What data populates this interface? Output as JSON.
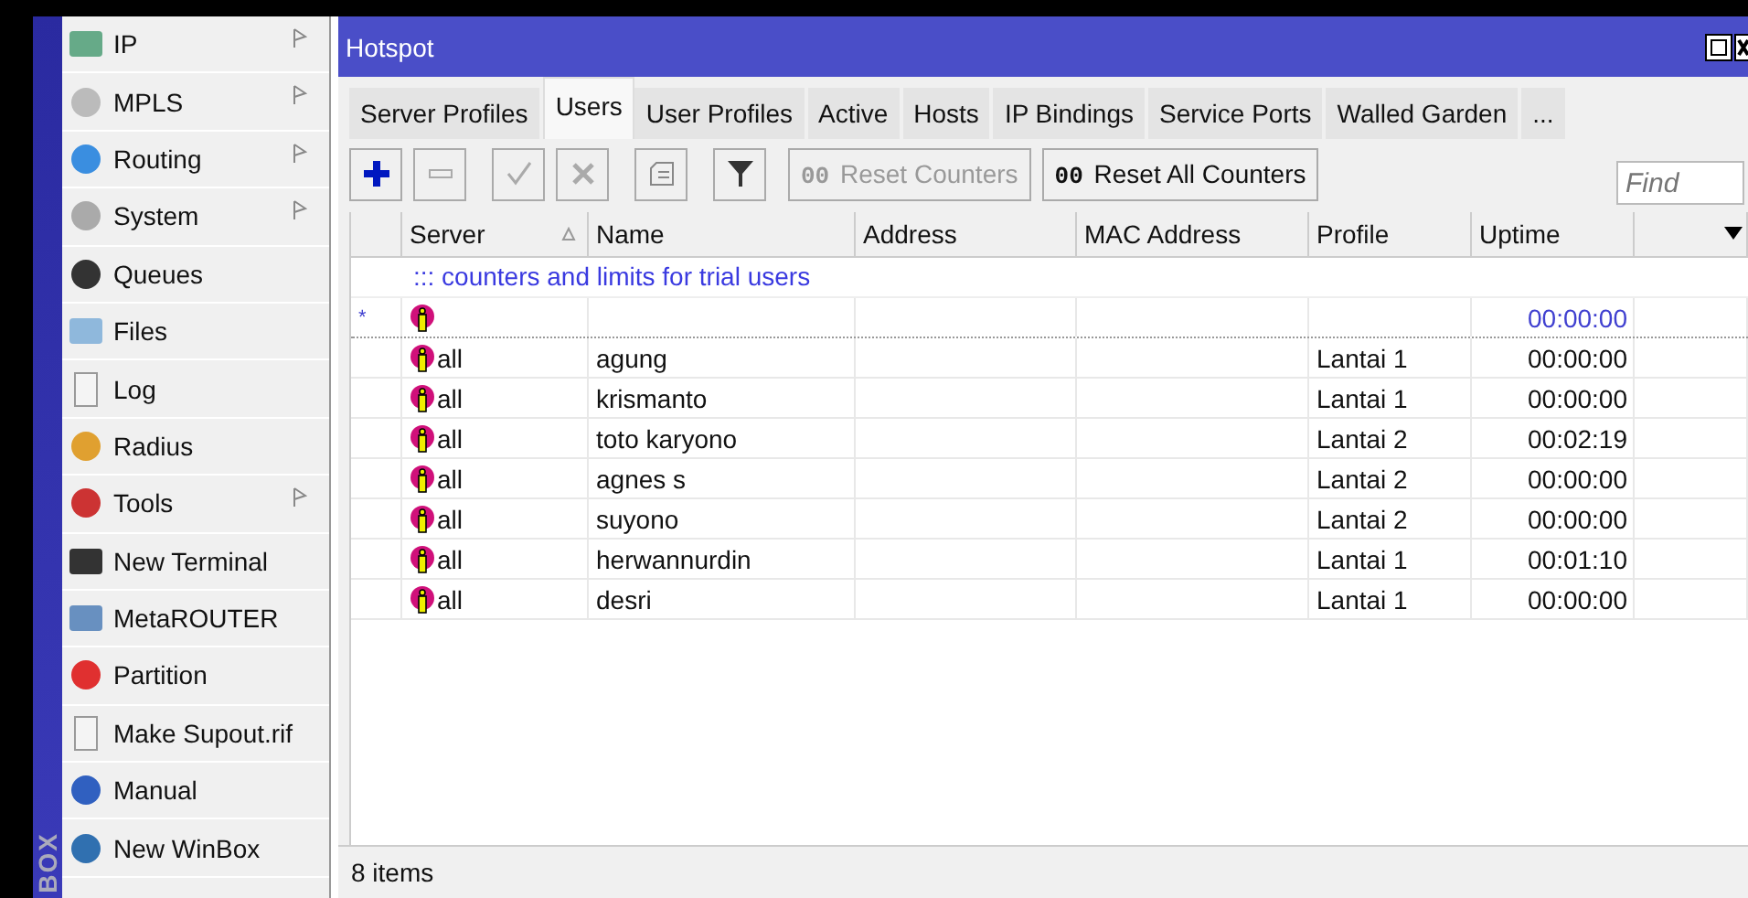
{
  "side_label": "BOX",
  "menu": [
    {
      "label": "IP",
      "submenu": true
    },
    {
      "label": "MPLS",
      "submenu": true
    },
    {
      "label": "Routing",
      "submenu": true
    },
    {
      "label": "System",
      "submenu": true
    },
    {
      "label": "Queues",
      "submenu": false
    },
    {
      "label": "Files",
      "submenu": false
    },
    {
      "label": "Log",
      "submenu": false
    },
    {
      "label": "Radius",
      "submenu": false
    },
    {
      "label": "Tools",
      "submenu": true
    },
    {
      "label": "New Terminal",
      "submenu": false
    },
    {
      "label": "MetaROUTER",
      "submenu": false
    },
    {
      "label": "Partition",
      "submenu": false
    },
    {
      "label": "Make Supout.rif",
      "submenu": false
    },
    {
      "label": "Manual",
      "submenu": false
    },
    {
      "label": "New WinBox",
      "submenu": false
    }
  ],
  "window": {
    "title": "Hotspot"
  },
  "tabs": [
    {
      "label": "Server Profiles",
      "selected": false
    },
    {
      "label": "Users",
      "selected": true
    },
    {
      "label": "User Profiles",
      "selected": false
    },
    {
      "label": "Active",
      "selected": false
    },
    {
      "label": "Hosts",
      "selected": false
    },
    {
      "label": "IP Bindings",
      "selected": false
    },
    {
      "label": "Service Ports",
      "selected": false
    },
    {
      "label": "Walled Garden",
      "selected": false
    },
    {
      "label": "...",
      "selected": false
    }
  ],
  "toolbar": [
    {
      "kind": "add",
      "disabled": false
    },
    {
      "kind": "remove",
      "disabled": true
    },
    {
      "kind": "enable",
      "disabled": true
    },
    {
      "kind": "disable",
      "disabled": true
    },
    {
      "kind": "comment",
      "disabled": true
    },
    {
      "kind": "filter",
      "disabled": false
    }
  ],
  "counter_buttons": [
    {
      "prefix": "00",
      "label": "Reset Counters",
      "disabled": true
    },
    {
      "prefix": "00",
      "label": "Reset All Counters",
      "disabled": false
    }
  ],
  "search": {
    "placeholder": "Find"
  },
  "table": {
    "columns": [
      "Server",
      "Name",
      "Address",
      "MAC Address",
      "Profile",
      "Uptime"
    ],
    "rows": [
      {
        "flag": "*",
        "comment": "::: counters and limits for trial users",
        "server": "",
        "name": "",
        "profile": "",
        "uptime": "00:00:00",
        "dynamic": true
      },
      {
        "server": "all",
        "name": "agung",
        "profile": "Lantai 1",
        "uptime": "00:00:00",
        "dynamic": false
      },
      {
        "server": "all",
        "name": "krismanto",
        "profile": "Lantai 1",
        "uptime": "00:00:00",
        "dynamic": false
      },
      {
        "server": "all",
        "name": "toto karyono",
        "profile": "Lantai 2",
        "uptime": "00:02:19",
        "dynamic": false
      },
      {
        "server": "all",
        "name": "agnes s",
        "profile": "Lantai 2",
        "uptime": "00:00:00",
        "dynamic": false
      },
      {
        "server": "all",
        "name": "suyono",
        "profile": "Lantai 2",
        "uptime": "00:00:00",
        "dynamic": false
      },
      {
        "server": "all",
        "name": "herwannurdin",
        "profile": "Lantai 1",
        "uptime": "00:01:10",
        "dynamic": false
      },
      {
        "server": "all",
        "name": "desri",
        "profile": "Lantai 1",
        "uptime": "00:00:00",
        "dynamic": false
      }
    ]
  },
  "status_bar": "8 items"
}
